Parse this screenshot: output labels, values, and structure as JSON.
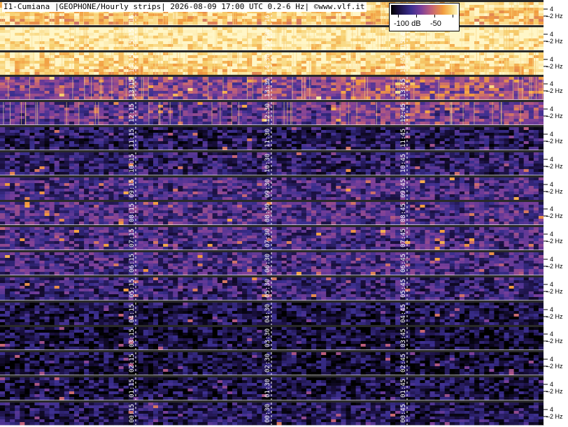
{
  "header": {
    "title": "I1-Cumiana |GEOPHONE/Hourly strips| 2026-08-09 17:00 UTC 0.2-6 Hz| ©www.vlf.it"
  },
  "colorbar": {
    "labels": [
      "-100 dB",
      "-50"
    ],
    "stops": [
      "#000000",
      "#1a1040",
      "#3b2f8f",
      "#7a3f9a",
      "#c0607a",
      "#f19a3f",
      "#f7d070",
      "#fff6c8"
    ]
  },
  "axis": {
    "tick_4": "4",
    "tick_2": "2 Hz"
  },
  "strips": [
    {
      "hour": "16",
      "marks": [
        "16:15",
        "16:30",
        "16:45"
      ],
      "intensity": 0.78,
      "tone": "hot"
    },
    {
      "hour": "15",
      "marks": [
        "15:15",
        "15:30",
        "15:45"
      ],
      "intensity": 0.9,
      "tone": "hot"
    },
    {
      "hour": "14",
      "marks": [
        "14:15",
        "14:30",
        "14:45"
      ],
      "intensity": 0.82,
      "tone": "hot"
    },
    {
      "hour": "13",
      "marks": [
        "13:15",
        "13:30",
        "13:45"
      ],
      "intensity": 0.45,
      "tone": "mixed"
    },
    {
      "hour": "12",
      "marks": [
        "12:15",
        "12:30",
        "12:45"
      ],
      "intensity": 0.35,
      "tone": "mixed"
    },
    {
      "hour": "11",
      "marks": [
        "11:15",
        "11:30",
        "11:45"
      ],
      "intensity": 0.18,
      "tone": "cool"
    },
    {
      "hour": "10",
      "marks": [
        "10:15",
        "10:30",
        "10:45"
      ],
      "intensity": 0.22,
      "tone": "cool"
    },
    {
      "hour": "09",
      "marks": [
        "09:15",
        "09:30",
        "09:45"
      ],
      "intensity": 0.3,
      "tone": "cool"
    },
    {
      "hour": "08",
      "marks": [
        "08:15",
        "08:30",
        "08:45"
      ],
      "intensity": 0.32,
      "tone": "cool"
    },
    {
      "hour": "07",
      "marks": [
        "07:15",
        "07:30",
        "07:45"
      ],
      "intensity": 0.3,
      "tone": "cool"
    },
    {
      "hour": "06",
      "marks": [
        "06:15",
        "06:30",
        "06:45"
      ],
      "intensity": 0.3,
      "tone": "cool"
    },
    {
      "hour": "05",
      "marks": [
        "05:15",
        "05:30",
        "05:45"
      ],
      "intensity": 0.25,
      "tone": "cool"
    },
    {
      "hour": "04",
      "marks": [
        "04:15",
        "04:30",
        "04:45"
      ],
      "intensity": 0.15,
      "tone": "cool"
    },
    {
      "hour": "03",
      "marks": [
        "03:15",
        "03:30",
        "03:45"
      ],
      "intensity": 0.12,
      "tone": "cool"
    },
    {
      "hour": "02",
      "marks": [
        "02:15",
        "02:30",
        "02:45"
      ],
      "intensity": 0.12,
      "tone": "cool"
    },
    {
      "hour": "01",
      "marks": [
        "01:15",
        "01:30",
        "01:45"
      ],
      "intensity": 0.14,
      "tone": "cool"
    },
    {
      "hour": "00",
      "marks": [
        "00:15",
        "00:30",
        "00:45"
      ],
      "intensity": 0.18,
      "tone": "cool"
    }
  ]
}
